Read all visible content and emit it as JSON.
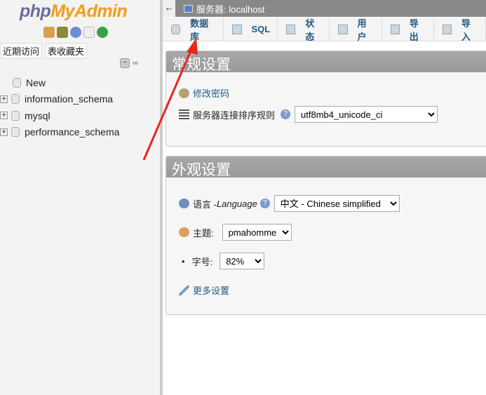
{
  "sidebar": {
    "logo_php": "php",
    "logo_myadmin": "MyAdmin",
    "icons": [
      "home-icon",
      "logout-icon",
      "help-icon",
      "docs-icon",
      "reload-icon"
    ],
    "tabs": [
      "近期访问",
      "表收藏夹"
    ],
    "tree": [
      {
        "label": "New"
      },
      {
        "label": "information_schema"
      },
      {
        "label": "mysql"
      },
      {
        "label": "performance_schema"
      }
    ]
  },
  "topbar": {
    "back": "←",
    "server": "服务器: localhost"
  },
  "tabs": [
    {
      "label": "数据库"
    },
    {
      "label": "SQL"
    },
    {
      "label": "状态"
    },
    {
      "label": "用户"
    },
    {
      "label": "导出"
    },
    {
      "label": "导入"
    }
  ],
  "general": {
    "title": "常规设置",
    "change_password": "修改密码",
    "collation_label": "服务器连接排序规则",
    "collation_value": "utf8mb4_unicode_ci"
  },
  "appearance": {
    "title": "外观设置",
    "language_label": "语言 - ",
    "language_label_en": "Language",
    "language_value": "中文 - Chinese simplified",
    "theme_label": "主题:",
    "theme_value": "pmahomme",
    "font_label": "字号:",
    "font_value": "82%",
    "more": "更多设置"
  },
  "annotation_color": "#e8261e"
}
